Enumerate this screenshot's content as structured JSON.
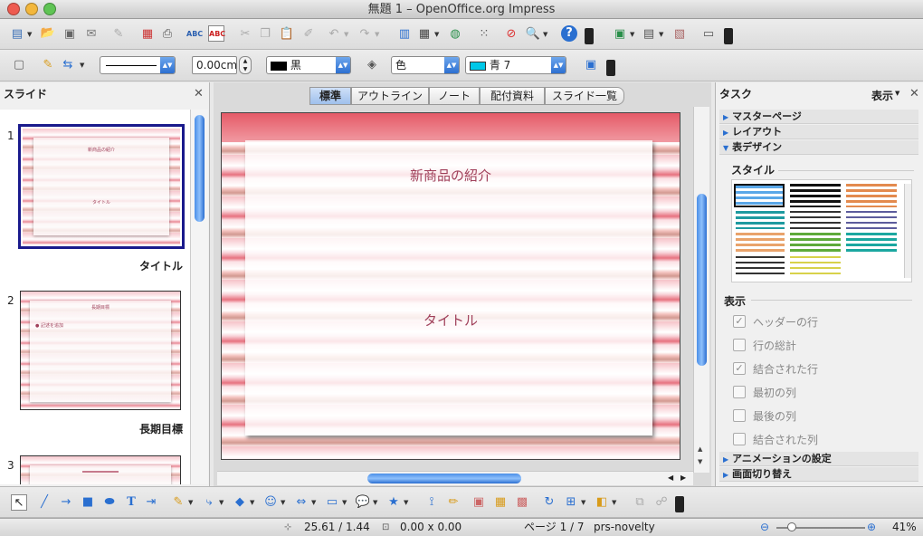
{
  "window": {
    "title": "無題 1 – OpenOffice.org Impress"
  },
  "toolbar2": {
    "line_width": "0.00cm",
    "line_color": "黒",
    "area_style": "色",
    "area_color": "青 7"
  },
  "slides_panel": {
    "title": "スライド",
    "slides": [
      {
        "number": "1",
        "caption": "タイトル",
        "title_text": "新商品の紹介",
        "body_text": "タイトル"
      },
      {
        "number": "2",
        "caption": "長期目標",
        "title_text": "長期目標",
        "body_text": "● 記述を追加"
      },
      {
        "number": "3",
        "caption": "",
        "title_text": "",
        "body_text": ""
      }
    ]
  },
  "view_tabs": [
    "標準",
    "アウトライン",
    "ノート",
    "配付資料",
    "スライド一覧"
  ],
  "main_slide": {
    "title": "新商品の紹介",
    "subtitle": "タイトル"
  },
  "task_panel": {
    "title": "タスク",
    "view_menu": "表示",
    "sections": {
      "master": "マスターページ",
      "layout": "レイアウト",
      "table_design": "表デザイン",
      "animation": "アニメーションの設定",
      "transition": "画面切り替え"
    },
    "style_label": "スタイル",
    "show_label": "表示",
    "options": [
      {
        "label": "ヘッダーの行",
        "checked": true
      },
      {
        "label": "行の総計",
        "checked": false
      },
      {
        "label": "結合された行",
        "checked": true
      },
      {
        "label": "最初の列",
        "checked": false
      },
      {
        "label": "最後の列",
        "checked": false
      },
      {
        "label": "結合された列",
        "checked": false
      }
    ]
  },
  "status": {
    "position": "25.61 / 1.44",
    "size": "0.00 x 0.00",
    "page": "ページ 1 / 7",
    "master": "prs-novelty",
    "zoom": "41%"
  },
  "colors": {
    "accent": "#2c6fd1",
    "slide_title": "#a0405a",
    "selection_border": "#1a1a8c"
  }
}
